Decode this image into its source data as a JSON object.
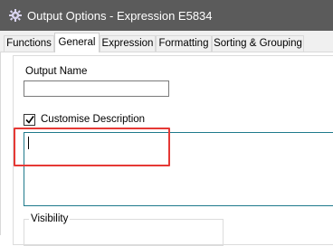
{
  "window": {
    "title": "Output Options - Expression E5834",
    "icon": "gear-icon"
  },
  "tabs": [
    {
      "label": "Functions",
      "active": false
    },
    {
      "label": "General",
      "active": true
    },
    {
      "label": "Expression",
      "active": false
    },
    {
      "label": "Formatting",
      "active": false
    },
    {
      "label": "Sorting & Grouping",
      "active": false
    }
  ],
  "general": {
    "output_name_label": "Output Name",
    "output_name_value": "",
    "customise_description_label": "Customise Description",
    "customise_description_checked": true,
    "description_value": "",
    "visibility_label": "Visibility"
  },
  "colors": {
    "titlebar": "#5b5b5b",
    "highlight": "#e53935",
    "focus_border": "#1f7a8c"
  }
}
